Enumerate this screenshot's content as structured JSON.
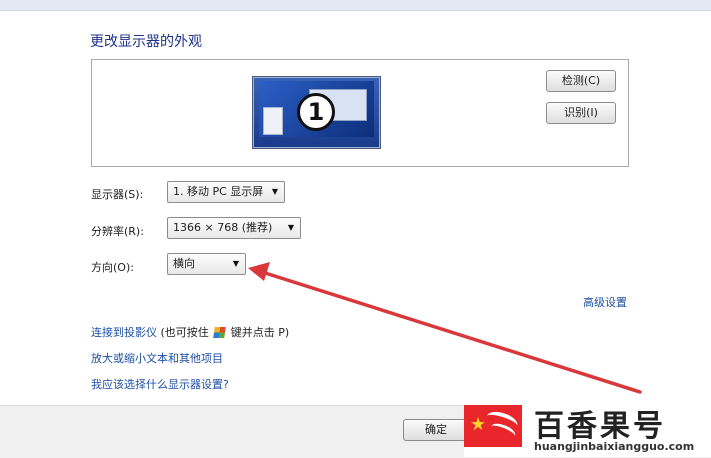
{
  "dialog": {
    "title": "更改显示器的外观",
    "detect_button": "检测(C)",
    "identify_button": "识别(I)",
    "monitor_number": "1",
    "display_label": "显示器(S):",
    "display_value": "1. 移动 PC 显示屏",
    "resolution_label": "分辨率(R):",
    "resolution_value": "1366 × 768 (推荐)",
    "orientation_label": "方向(O):",
    "orientation_value": "横向",
    "advanced_link": "高级设置",
    "projector_link": "连接到投影仪",
    "projector_hint_pre": "(也可按住",
    "projector_hint_post": "键并点击 P)",
    "enlarge_link": "放大或缩小文本和其他项目",
    "which_link": "我应该选择什么显示器设置?",
    "ok_button": "确定"
  },
  "watermark": {
    "brand": "百香果号",
    "url": "huangjinbaixiangguo.com"
  },
  "colors": {
    "title": "#1e3287",
    "link": "#1e50a2",
    "annotation_arrow": "#d9373a",
    "watermark_red": "#e8262c"
  },
  "icons": [
    "monitor-icon",
    "windows-key-icon",
    "dropdown-arrow-icon"
  ]
}
